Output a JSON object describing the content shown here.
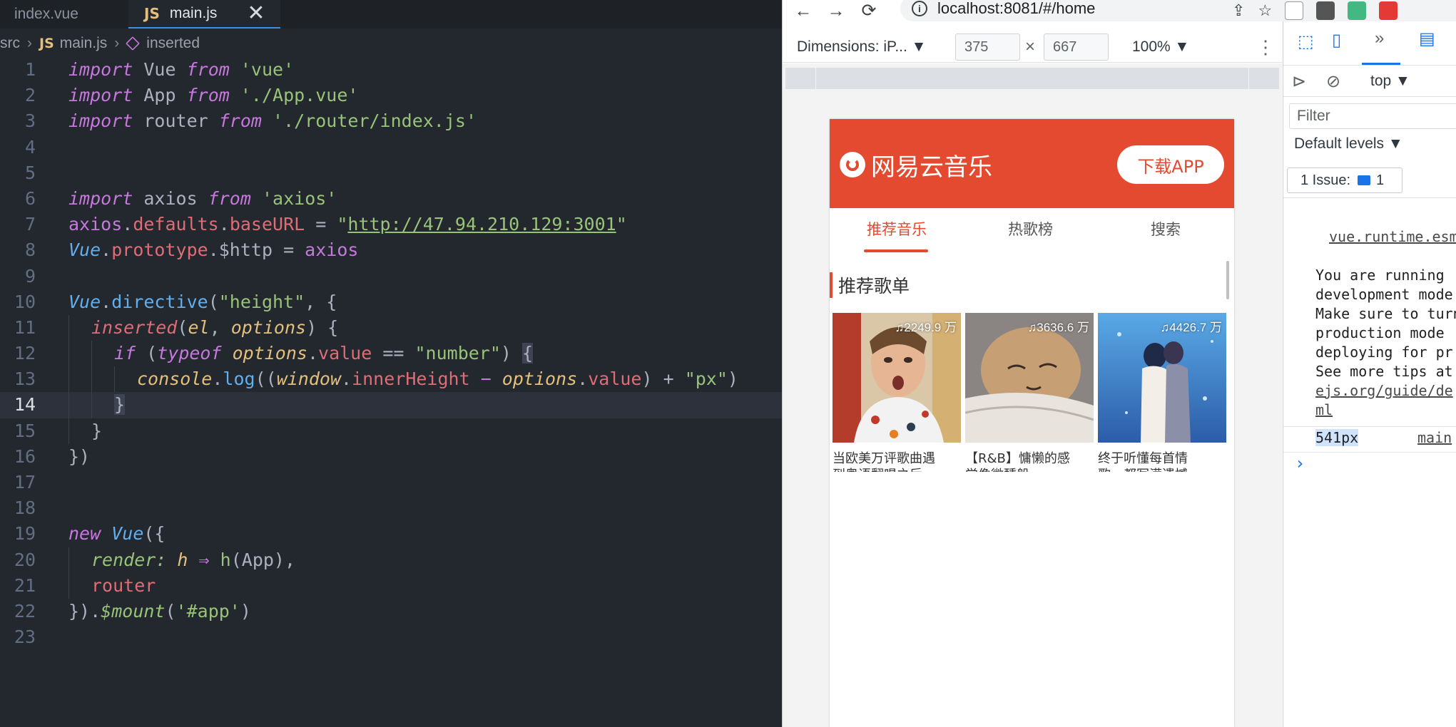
{
  "editor": {
    "tabs": [
      {
        "label": "index.vue",
        "active": false
      },
      {
        "label": "main.js",
        "badge": "JS",
        "active": true,
        "close": "✕"
      }
    ],
    "breadcrumb": {
      "folder": "src",
      "file_badge": "JS",
      "file": "main.js",
      "symbol": "inserted"
    },
    "line_numbers": [
      "1",
      "2",
      "3",
      "4",
      "5",
      "6",
      "7",
      "8",
      "9",
      "10",
      "11",
      "12",
      "13",
      "14",
      "15",
      "16",
      "17",
      "18",
      "19",
      "20",
      "21",
      "22",
      "23"
    ],
    "current_line": "14",
    "code": {
      "l1": {
        "import": "import",
        "name": "Vue",
        "from": "from",
        "src": "'vue'"
      },
      "l2": {
        "import": "import",
        "name": "App",
        "from": "from",
        "src": "'./App.vue'"
      },
      "l3": {
        "import": "import",
        "name": "router",
        "from": "from",
        "src": "'./router/index.js'"
      },
      "l6": {
        "import": "import",
        "name": "axios",
        "from": "from",
        "src": "'axios'"
      },
      "l7": {
        "obj": "axios",
        "dot1": ".",
        "prop1": "defaults",
        "dot2": ".",
        "prop2": "baseURL",
        "eq": " = ",
        "q1": "\"",
        "url": "http://47.94.210.129:3001",
        "q2": "\""
      },
      "l8": {
        "obj": "Vue",
        "dot1": ".",
        "prop1": "prototype",
        "dot2": ".",
        "prop2": "$http",
        "eq": " = ",
        "val": "axios"
      },
      "l10": {
        "obj": "Vue",
        "dot": ".",
        "fn": "directive",
        "open": "(",
        "arg": "\"height\"",
        "rest": ", {"
      },
      "l11": {
        "fn": "inserted",
        "open": "(",
        "a1": "el",
        "comma": ", ",
        "a2": "options",
        "rest": ") {"
      },
      "l12": {
        "kw": "if",
        "sp": " (",
        "typeof": "typeof",
        "sp2": " ",
        "opt": "options",
        "dot": ".",
        "val": "value",
        "eq": " == ",
        "str": "\"number\"",
        "close": ") ",
        "brace": "{"
      },
      "l13": {
        "obj": "console",
        "dot": ".",
        "fn": "log",
        "open": "((",
        "win": "window",
        "dot2": ".",
        "ih": "innerHeight",
        "minus": " − ",
        "opt": "options",
        "dot3": ".",
        "val": "value",
        "close": ") + ",
        "str": "\"px\"",
        "end": ")"
      },
      "l14": {
        "brace": "}"
      },
      "l15": {
        "brace": "}"
      },
      "l16": {
        "text": "})"
      },
      "l19": {
        "kw": "new",
        "sp": " ",
        "cls": "Vue",
        "rest": "({"
      },
      "l20": {
        "prop": "render:",
        "sp": " ",
        "h": "h",
        "arrow": " ⇒ ",
        "h2": "h",
        "open": "(",
        "app": "App",
        "rest": "),"
      },
      "l21": {
        "name": "router"
      },
      "l22": {
        "open": "})",
        "dot": ".",
        "fn": "$mount",
        "p1": "(",
        "str": "'#app'",
        "p2": ")"
      }
    }
  },
  "browser": {
    "nav": {
      "back": "←",
      "forward": "→",
      "reload": "⟳",
      "url": "localhost:8081/#/home",
      "info": "i",
      "share": "⇪",
      "star": "☆"
    },
    "device_toolbar": {
      "device": "Dimensions: iP... ▼",
      "width": "375",
      "x": "×",
      "height": "667",
      "zoom": "100% ▼",
      "more": "⋮"
    },
    "app": {
      "title": "网易云音乐",
      "download": "下载APP",
      "tabs": [
        "推荐音乐",
        "热歌榜",
        "搜索"
      ],
      "section": "推荐歌单",
      "cards": [
        {
          "plays": "♫2249.9 万",
          "title": "当欧美万评歌曲遇",
          "title2": "到粤语翻唱之后"
        },
        {
          "plays": "♫3636.6 万",
          "title": "【R&B】慵懒的感",
          "title2": "觉像微醺般"
        },
        {
          "plays": "♫4426.7 万",
          "title": "终于听懂每首情",
          "title2": "歌，都写满遗憾"
        }
      ],
      "colors": {
        "brand": "#e34a2f"
      }
    }
  },
  "devtools": {
    "top": {
      "more_tabs": "»"
    },
    "context": "top ▼",
    "filter_placeholder": "Filter",
    "levels": "Default levels ▼",
    "issues": {
      "label": "1 Issue:",
      "count": "1"
    },
    "console": {
      "source_link": "vue.runtime.esm",
      "message": [
        "You are running",
        "development mode",
        "Make sure to turn",
        "production mode",
        "deploying for pr",
        "See more tips at"
      ],
      "link1": "ejs.org/guide/de",
      "link2": "ml",
      "log_value": "541px",
      "log_source": "main",
      "prompt": "›"
    }
  }
}
